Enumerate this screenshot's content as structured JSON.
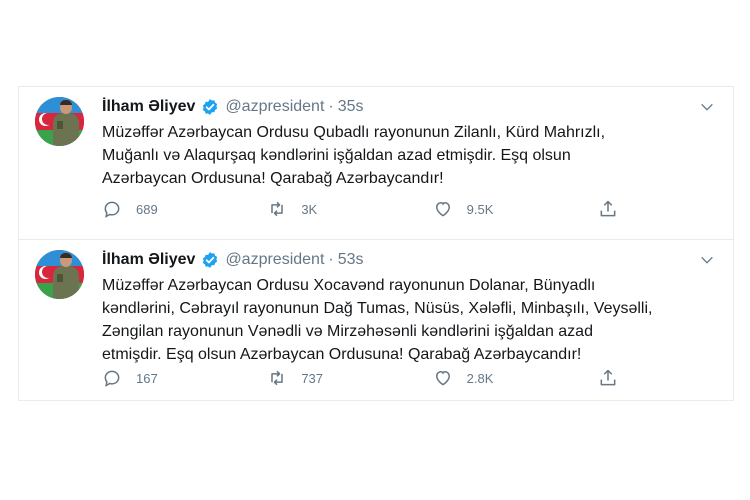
{
  "tweets": [
    {
      "name": "İlham Əliyev",
      "handle": "@azpresident",
      "separator": "·",
      "time": "35s",
      "text": "Müzəffər Azərbaycan Ordusu Qubadlı rayonunun Zilanlı, Kürd Mahrızlı,\nMuğanlı və Alaqurşaq kəndlərini işğaldan azad etmişdir. Eşq olsun\nAzərbaycan Ordusuna! Qarabağ Azərbaycandır!",
      "replies": "689",
      "retweets": "3K",
      "likes": "9.5K"
    },
    {
      "name": "İlham Əliyev",
      "handle": "@azpresident",
      "separator": "·",
      "time": "53s",
      "text": "Müzəffər Azərbaycan Ordusu Xocavənd rayonunun Dolanar, Bünyadlı\nkəndlərini, Cəbrayıl rayonunun Dağ Tumas, Nüsüs, Xələfli, Minbaşılı, Veysəlli,\nZəngilan rayonunun Vənədli və Mirzəhəsənli kəndlərini işğaldan azad\netmişdir. Eşq olsun Azərbaycan Ordusuna! Qarabağ Azərbaycandır!",
      "replies": "167",
      "retweets": "737",
      "likes": "2.8K"
    }
  ],
  "icons": {
    "verified": "verified-badge-icon",
    "menu": "chevron-down-icon",
    "reply": "reply-icon",
    "retweet": "retweet-icon",
    "like": "heart-icon",
    "share": "share-icon"
  },
  "colors": {
    "text": "#14171a",
    "muted": "#657786",
    "verified": "#1da1f2",
    "border": "#e6ecf0"
  }
}
